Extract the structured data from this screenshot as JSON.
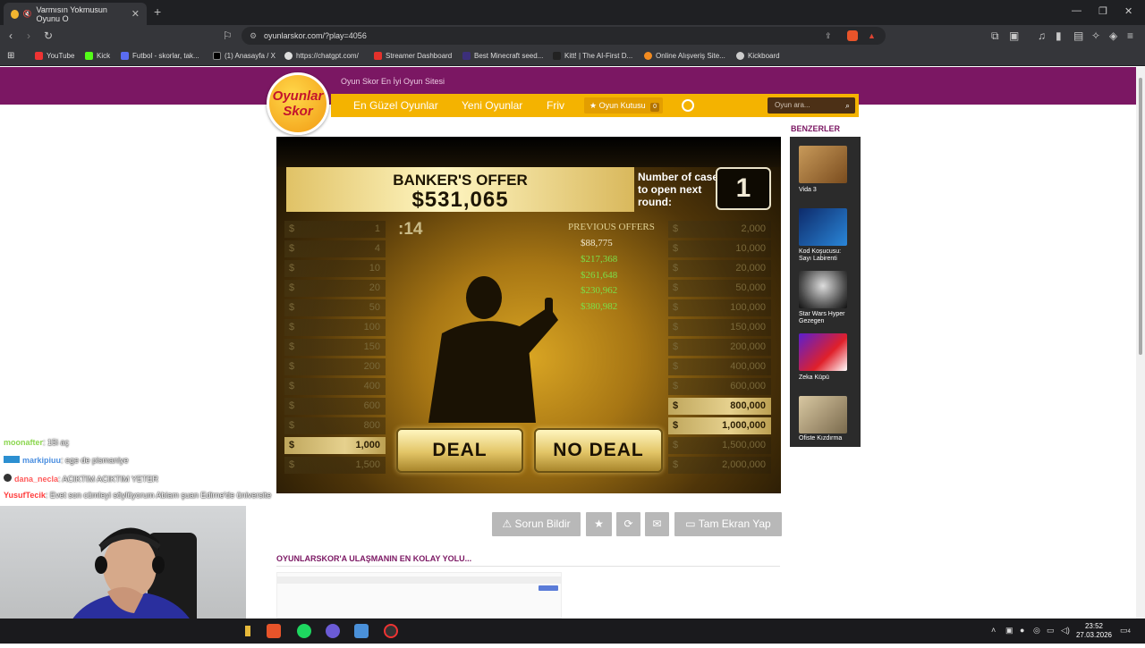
{
  "browser": {
    "tab_title": "Varmısın Yokmusun Oyunu O",
    "new_tab": "+",
    "close": "✕",
    "url": "oyunlarskor.com/?play=4056",
    "bookmarks": [
      "YouTube",
      "Kick",
      "Futbol - skorlar, tak...",
      "(1) Anasayfa / X",
      "https://chatgpt.com/",
      "Streamer Dashboard",
      "Best Minecraft seed...",
      "Kitt! | The AI-First D...",
      "Online Alışveriş Site...",
      "Kickboard"
    ],
    "window_controls": [
      "—",
      "❐",
      "✕"
    ]
  },
  "site": {
    "logo": [
      "Oyunlar",
      "Skor"
    ],
    "tagline": "Oyun Skor En İyi Oyun Sitesi",
    "nav": [
      "En Güzel Oyunlar",
      "Yeni Oyunlar",
      "Friv"
    ],
    "box_label": "Oyun Kutusu",
    "box_count": "0",
    "search_placeholder": "Oyun ara..."
  },
  "game": {
    "offer_label": "BANKER'S OFFER",
    "offer_value": "$531,065",
    "cases_label": "Number of cases to open next round:",
    "cases_count": "1",
    "timer": ":14",
    "previous_label": "PREVIOUS OFFERS",
    "previous_offers": [
      "$88,775",
      "$217,368",
      "$261,648",
      "$230,962",
      "$380,982"
    ],
    "left_values": [
      "1",
      "4",
      "10",
      "20",
      "50",
      "100",
      "150",
      "200",
      "400",
      "600",
      "800",
      "1,000",
      "1,500"
    ],
    "right_values": [
      "2,000",
      "10,000",
      "20,000",
      "50,000",
      "100,000",
      "150,000",
      "200,000",
      "400,000",
      "600,000",
      "800,000",
      "1,000,000",
      "1,500,000",
      "2,000,000"
    ],
    "left_lit": [
      false,
      false,
      false,
      false,
      false,
      false,
      false,
      false,
      false,
      false,
      false,
      true,
      false
    ],
    "right_lit": [
      false,
      false,
      false,
      false,
      false,
      false,
      false,
      false,
      false,
      true,
      true,
      false,
      false
    ],
    "dollar": "$",
    "deal": "DEAL",
    "no_deal": "NO DEAL"
  },
  "sidebar": {
    "title": "BENZERLER",
    "items": [
      "Vida 3",
      "Kod Koşucusu: Sayı Labirenti",
      "Star Wars Hyper Gezegen",
      "Zeka Küpü",
      "Ofiste Kızdırma"
    ]
  },
  "actions": {
    "report": "Sorun Bildir",
    "fullscreen": "Tam Ekran Yap"
  },
  "section_title": "OYUNLARSKOR'A ULAŞMANIN EN KOLAY YOLU...",
  "chat": [
    {
      "user": "moonafter",
      "msg": ": 15i aç",
      "color": "#8bd64f"
    },
    {
      "user": "markipiuu",
      "msg": ": ege de pismaniye",
      "color": "#4b8fe0"
    },
    {
      "user": "dana_necla",
      "msg": ": ACIKTIM ACIKTIM YETER",
      "color": "#ff5b5b"
    },
    {
      "user": "YusufTecik",
      "msg": ": Evet son cümleyi söylüyorum Abiam şuan Edirne'de üniversite",
      "color": "#ff3b3b"
    }
  ],
  "clock": {
    "time": "23:52",
    "date": "27.03.2026"
  },
  "notif_count": "4",
  "colors": {
    "brand_purple": "#7b1763",
    "nav_yellow": "#f4b300"
  }
}
